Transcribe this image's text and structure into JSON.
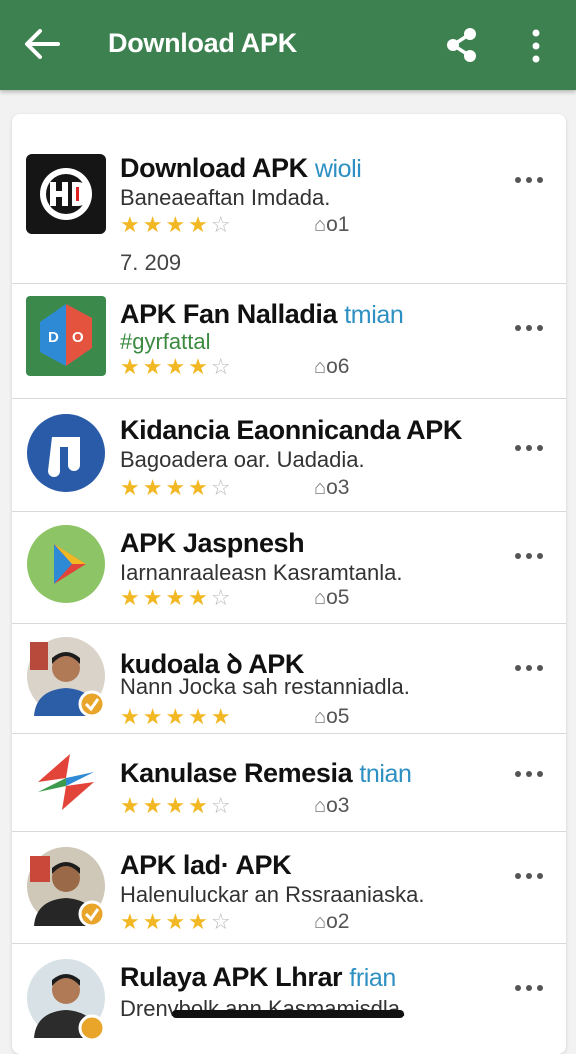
{
  "appbar": {
    "title": "Download APK",
    "back_icon": "arrow-back-icon",
    "share_icon": "share-icon",
    "menu_icon": "more-vertical-icon",
    "color": "#3d8150"
  },
  "items": [
    {
      "name": "Download APK",
      "tag": "wioli",
      "subtitle": "Baneaeaftan Imdada.",
      "stars": "★★★★",
      "stars_off": "☆",
      "count": "o1",
      "extra": "7. 209",
      "icon": "hd-logo-icon"
    },
    {
      "name": "APK Fan Nalladia",
      "tag": "tmian",
      "subtitle": "#gyrfattal",
      "stars": "★★★★",
      "stars_off": "☆",
      "count": "o6",
      "icon": "do-logo-icon"
    },
    {
      "name": "Kidancia Eaonnicanda APK",
      "tag": "",
      "subtitle": "Bagoadera oar. Uadadia.",
      "stars": "★★★★",
      "stars_off": "☆",
      "count": "o3",
      "icon": "note-logo-icon"
    },
    {
      "name": "APK Jaspnesh",
      "tag": "",
      "subtitle": "Iarnanraaleasn Kasramtanla.",
      "stars": "★★★★",
      "stars_off": "☆",
      "count": "o5",
      "icon": "play-logo-icon"
    },
    {
      "name": "kudoala ꝺ APK",
      "tag": "",
      "subtitle": "Nann Jocka sah restanniadla.",
      "stars": "★★★★★",
      "stars_off": "",
      "count": "o5",
      "icon": "user-avatar-verified-icon"
    },
    {
      "name": "Kanulase Remesia",
      "tag": "tnian",
      "subtitle": "",
      "stars": "★★★★",
      "stars_off": "☆",
      "count": "o3",
      "icon": "swirl-logo-icon"
    },
    {
      "name": "APK lad· APK",
      "tag": "",
      "subtitle": "Halenuluckar an Rssraaniaska.",
      "stars": "★★★★",
      "stars_off": "☆",
      "count": "o2",
      "icon": "user-avatar-verified-icon"
    },
    {
      "name": "Rulaya APK Lhrar",
      "tag": "frian",
      "subtitle": "Drenvbolk ann Kasmamisdla.",
      "stars": "",
      "stars_off": "",
      "count": "",
      "icon": "user-avatar-verified-icon"
    }
  ],
  "colors": {
    "star": "#f2b824",
    "tag": "#2e8fc2",
    "verified": "#e8a52a"
  }
}
